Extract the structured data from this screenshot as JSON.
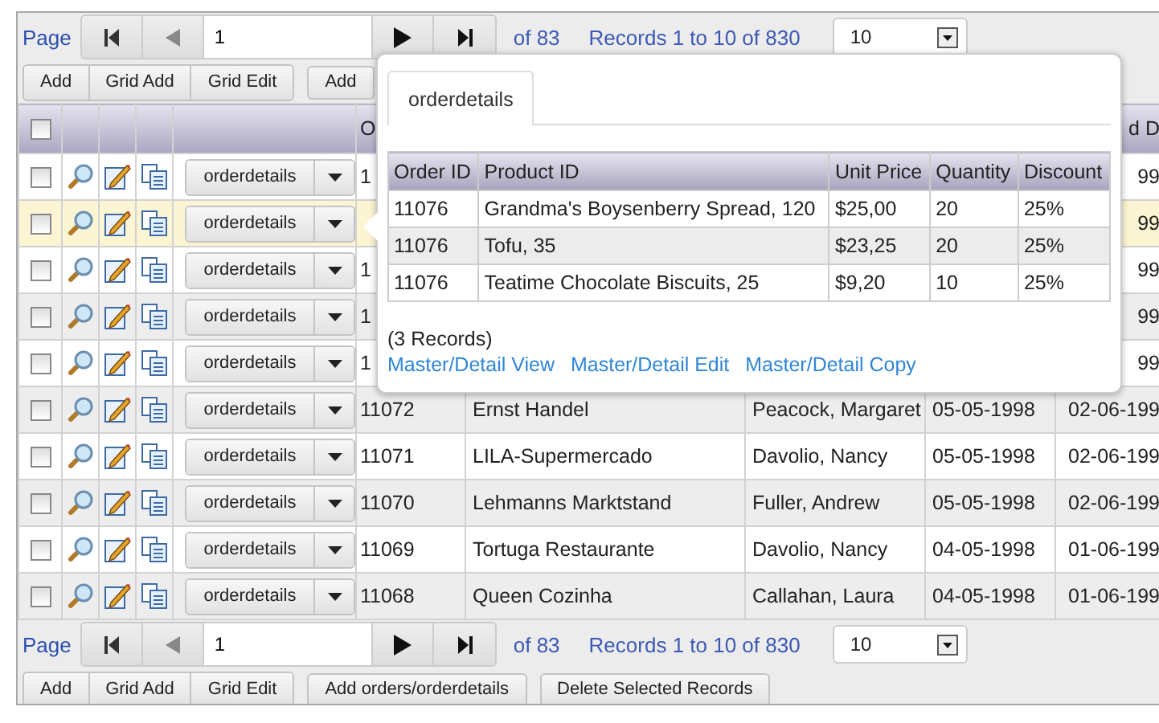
{
  "top_pager": {
    "label": "Page",
    "page": "1",
    "of": "of 83",
    "records": "Records 1 to 10 of 830",
    "page_size": "10"
  },
  "top_toolbar": {
    "group": [
      "Add",
      "Grid Add",
      "Grid Edit"
    ],
    "buttons": [
      "Add"
    ]
  },
  "grid": {
    "select_all_checked": false,
    "header": {
      "column_1": "O",
      "column_5": "d D"
    },
    "rows": [
      {
        "checked": false,
        "highlighted": false,
        "detail_button": "orderdetails",
        "cells": {
          "column_1": "1",
          "column_5": "99"
        }
      },
      {
        "checked": false,
        "highlighted": true,
        "detail_button": "orderdetails",
        "cells": {
          "column_5": "99"
        }
      },
      {
        "checked": false,
        "highlighted": false,
        "detail_button": "orderdetails",
        "cells": {
          "column_1": "1",
          "column_5": "99"
        }
      },
      {
        "checked": false,
        "highlighted": false,
        "detail_button": "orderdetails",
        "cells": {
          "column_1": "1",
          "column_5": "99"
        }
      },
      {
        "checked": false,
        "highlighted": false,
        "detail_button": "orderdetails",
        "cells": {
          "column_1": "1",
          "column_5": "99"
        }
      },
      {
        "checked": false,
        "highlighted": false,
        "detail_button": "orderdetails",
        "cells": {
          "column_1": "11072",
          "column_2": "Ernst Handel",
          "column_3": "Peacock, Margaret",
          "column_4": "05-05-1998",
          "column_5": "02-06-199"
        }
      },
      {
        "checked": false,
        "highlighted": false,
        "detail_button": "orderdetails",
        "cells": {
          "column_1": "11071",
          "column_2": "LILA-Supermercado",
          "column_3": "Davolio, Nancy",
          "column_4": "05-05-1998",
          "column_5": "02-06-199"
        }
      },
      {
        "checked": false,
        "highlighted": false,
        "detail_button": "orderdetails",
        "cells": {
          "column_1": "11070",
          "column_2": "Lehmanns Marktstand",
          "column_3": "Fuller, Andrew",
          "column_4": "05-05-1998",
          "column_5": "02-06-199"
        }
      },
      {
        "checked": false,
        "highlighted": false,
        "detail_button": "orderdetails",
        "cells": {
          "column_1": "11069",
          "column_2": "Tortuga Restaurante",
          "column_3": "Davolio, Nancy",
          "column_4": "04-05-1998",
          "column_5": "01-06-199"
        }
      },
      {
        "checked": false,
        "highlighted": false,
        "detail_button": "orderdetails",
        "cells": {
          "column_1": "11068",
          "column_2": "Queen Cozinha",
          "column_3": "Callahan, Laura",
          "column_4": "04-05-1998",
          "column_5": "01-06-199"
        }
      }
    ]
  },
  "bottom_pager": {
    "label": "Page",
    "page": "1",
    "of": "of 83",
    "records": "Records 1 to 10 of 830",
    "page_size": "10"
  },
  "bottom_toolbar": {
    "group": [
      "Add",
      "Grid Add",
      "Grid Edit"
    ],
    "buttons": [
      "Add orders/orderdetails",
      "Delete Selected Records"
    ]
  },
  "popup": {
    "tabs": [
      {
        "label": "orderdetails",
        "selected": true
      }
    ],
    "table": {
      "columns": [
        "Order ID",
        "Product ID",
        "Unit Price",
        "Quantity",
        "Discount"
      ],
      "rows": [
        [
          "11076",
          "Grandma's Boysenberry Spread, 120",
          "$25,00",
          "20",
          "25%"
        ],
        [
          "11076",
          "Tofu, 35",
          "$23,25",
          "20",
          "25%"
        ],
        [
          "11076",
          "Teatime Chocolate Biscuits, 25",
          "$9,20",
          "10",
          "25%"
        ]
      ]
    },
    "count": "(3 Records)",
    "links": [
      "Master/Detail View",
      "Master/Detail Edit",
      "Master/Detail Copy"
    ]
  }
}
